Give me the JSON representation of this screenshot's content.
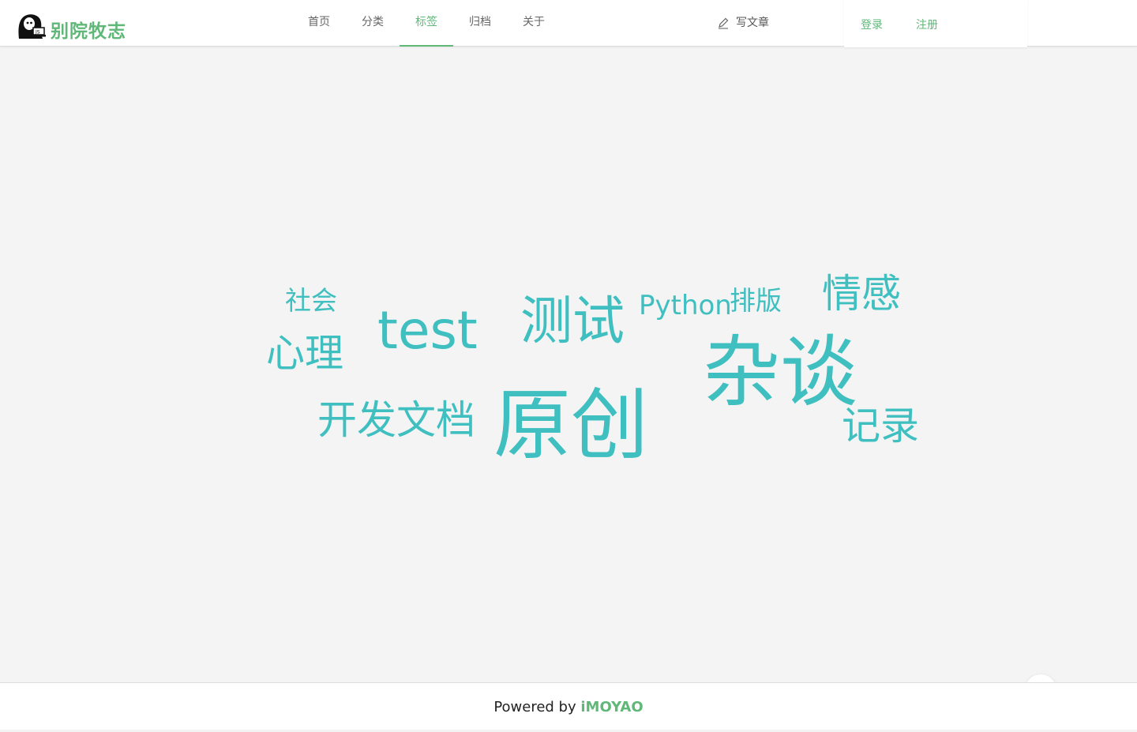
{
  "brand": {
    "name": "别院牧志",
    "color": "#5fb878",
    "icon": "ghost-laptop-logo-icon"
  },
  "nav": {
    "items": [
      {
        "label": "首页",
        "active": false
      },
      {
        "label": "分类",
        "active": false
      },
      {
        "label": "标签",
        "active": true
      },
      {
        "label": "归档",
        "active": false
      },
      {
        "label": "关于",
        "active": false
      }
    ],
    "write_label": "写文章",
    "write_icon": "pencil-icon"
  },
  "auth": {
    "login_label": "登录",
    "register_label": "注册"
  },
  "tags": {
    "color": "#3fbfbf",
    "items": [
      {
        "label": "社会"
      },
      {
        "label": "心理"
      },
      {
        "label": "test"
      },
      {
        "label": "测试"
      },
      {
        "label": "Python"
      },
      {
        "label": "排版"
      },
      {
        "label": "情感"
      },
      {
        "label": "杂谈"
      },
      {
        "label": "开发文档"
      },
      {
        "label": "原创"
      },
      {
        "label": "记录"
      }
    ]
  },
  "chat": {
    "icon": "chat-bubble-icon"
  },
  "footer": {
    "prefix": "Powered by ",
    "brand": "iMOYAO"
  }
}
